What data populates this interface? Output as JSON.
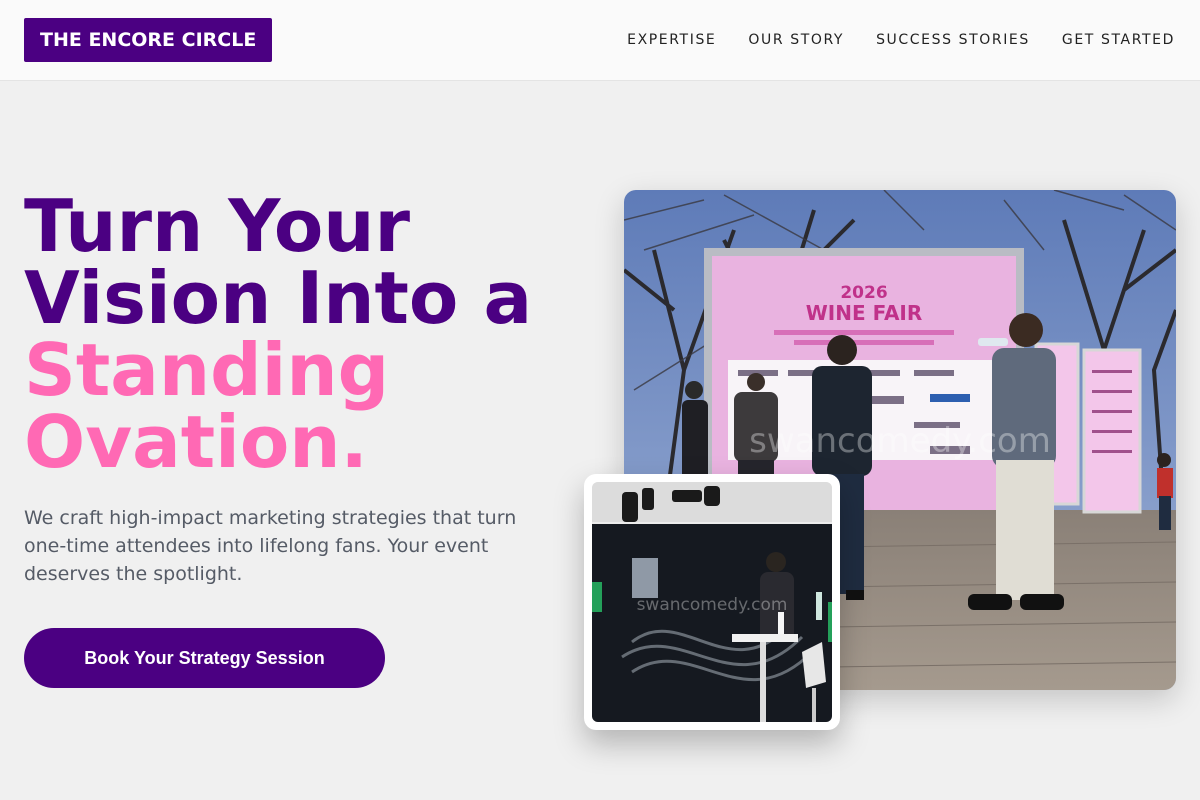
{
  "brand": {
    "name": "THE ENCORE CIRCLE",
    "color": "#4b0082"
  },
  "nav": {
    "items": [
      {
        "label": "EXPERTISE"
      },
      {
        "label": "OUR STORY"
      },
      {
        "label": "SUCCESS STORIES"
      },
      {
        "label": "GET STARTED"
      }
    ]
  },
  "hero": {
    "title_line1": "Turn Your",
    "title_line2": "Vision Into a",
    "title_accent1": "Standing",
    "title_accent2": "Ovation.",
    "description": "We craft high-impact marketing strategies that turn one-time attendees into lifelong fans. Your event deserves the spotlight.",
    "cta_label": "Book Your Strategy Session",
    "accent_color": "#ff69b4"
  },
  "images": {
    "main": {
      "banner_year": "2026",
      "banner_title": "WINE FAIR",
      "watermark": "swancomedy.com"
    },
    "inset": {
      "watermark": "swancomedy.com"
    }
  }
}
